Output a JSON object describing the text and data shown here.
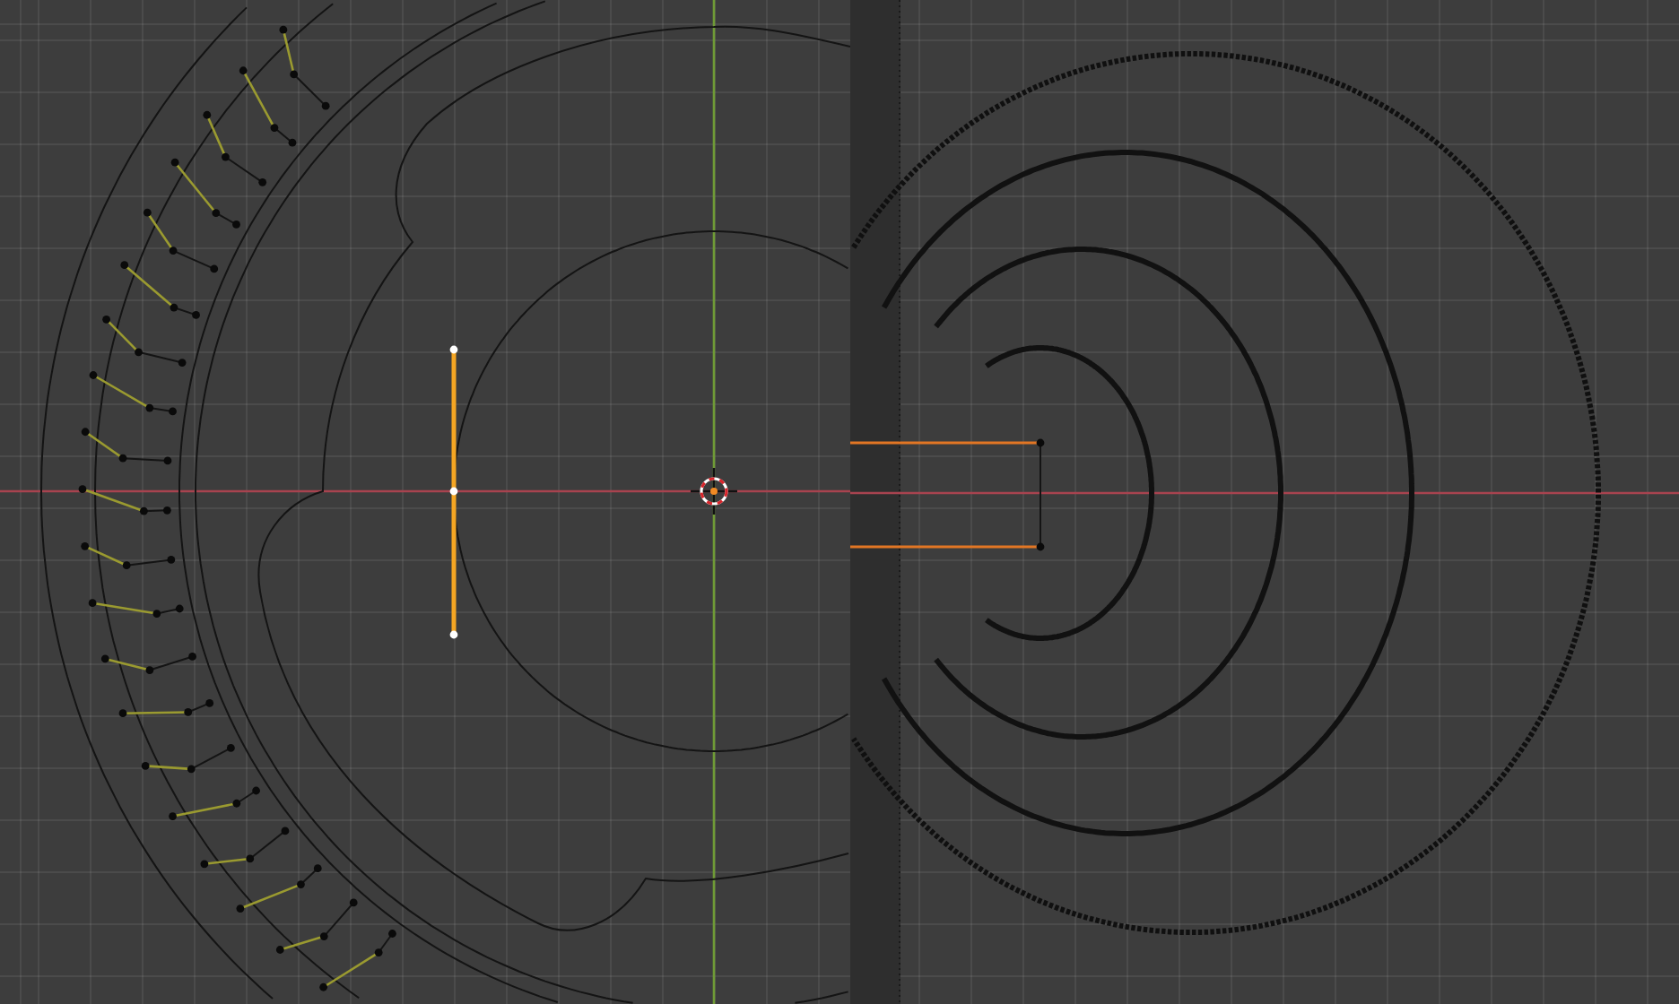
{
  "viewports": [
    {
      "kind": "mesh-edit"
    },
    {
      "kind": "curve-rings"
    }
  ]
}
